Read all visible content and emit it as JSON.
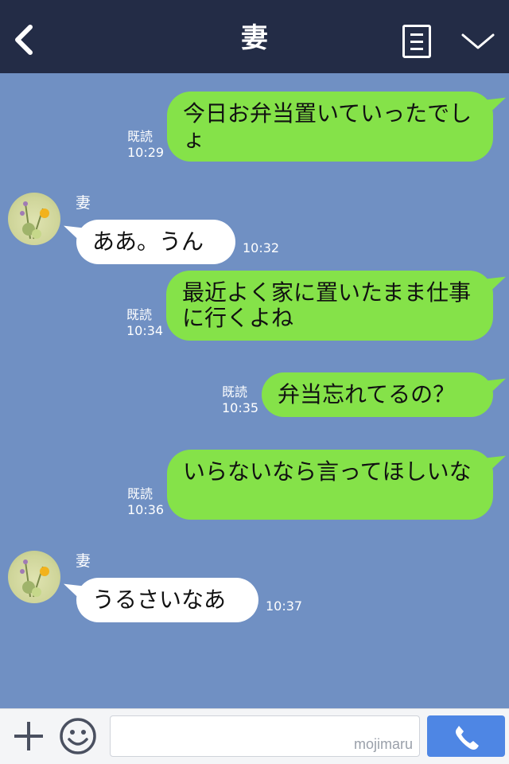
{
  "header": {
    "title": "妻",
    "back_icon": "chevron-left-icon",
    "notes_icon": "note-icon",
    "menu_icon": "chevron-down-icon",
    "bg_color": "#232c46"
  },
  "chat_bg_color": "#7090c3",
  "messages": [
    {
      "id": "m1",
      "side": "right",
      "text": "今日お弁当置いていったでしょ",
      "read": "既読",
      "time": "10:29"
    },
    {
      "id": "m2",
      "side": "left",
      "sender": "妻",
      "text": "ああ。うん",
      "time": "10:32"
    },
    {
      "id": "m3",
      "side": "right",
      "text": "最近よく家に置いたまま仕事に行くよね",
      "read": "既読",
      "time": "10:34"
    },
    {
      "id": "m4",
      "side": "right",
      "text": "弁当忘れてるの？",
      "read": "既読",
      "time": "10:35"
    },
    {
      "id": "m5",
      "side": "right",
      "text": "いらないなら言ってほしいな",
      "read": "既読",
      "time": "10:36"
    },
    {
      "id": "m6",
      "side": "left",
      "sender": "妻",
      "text": "うるさいなあ",
      "time": "10:37"
    }
  ],
  "bubble_colors": {
    "outgoing": "#85e249",
    "incoming": "#ffffff"
  },
  "input_bar": {
    "plus_icon": "plus-icon",
    "emoji_icon": "smiley-icon",
    "watermark": "mojimaru",
    "call_icon": "phone-icon",
    "call_color": "#4e86e4"
  }
}
